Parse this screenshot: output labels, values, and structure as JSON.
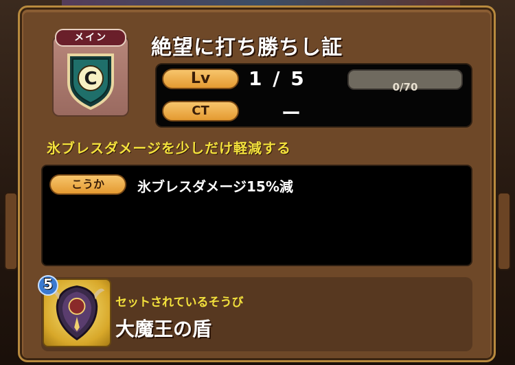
{
  "skill": {
    "tag": "メイン",
    "grade": "C",
    "title": "絶望に打ち勝ちし証",
    "level_label": "Lv",
    "level_value": "1 / 5",
    "exp_text": "0/70",
    "exp_fraction": 0.0,
    "ct_label": "CT",
    "ct_value": "ー",
    "description": "氷ブレスダメージを少しだけ軽減する"
  },
  "effect": {
    "label": "こうか",
    "text": "氷ブレスダメージ15%減"
  },
  "equipment": {
    "label": "セットされているそうび",
    "name": "大魔王の盾",
    "stars": "5",
    "icon": "demon-king-shield-icon"
  },
  "colors": {
    "accent_gold": "#f3e13c",
    "pill_orange": "#e49a31",
    "panel_brown": "#6e4828"
  }
}
